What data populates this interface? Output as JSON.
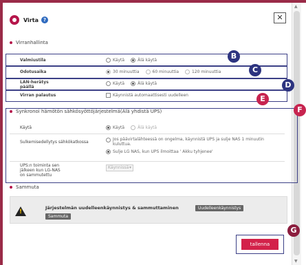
{
  "header": {
    "title": "Virta"
  },
  "sections": {
    "power_management": "Virranhallinta",
    "ups_sync": "Synkronoi hämötön sähkösyöttöjärjestelmä(Älä yhdistä UPS)",
    "shutdown": "Sammuta"
  },
  "power": {
    "standby": {
      "label": "Valmiustila",
      "options": [
        "Käytä",
        "Älä käytä"
      ],
      "selected": "Älä käytä"
    },
    "wait_time": {
      "label": "Odotusaika",
      "options": [
        "30 minuuttia",
        "60 minuuttia",
        "120 minuuttia"
      ],
      "selected": "30 minuuttia"
    },
    "lan_wakeup": {
      "label": "LAN-herätys päällä",
      "options": [
        "Käytä",
        "Älä käytä"
      ],
      "selected": "Älä käytä"
    },
    "power_restore": {
      "label": "Virran palautus",
      "checkbox_label": "Käynnistä automaattisesti uudelleen",
      "checked": false
    }
  },
  "ups": {
    "use": {
      "label": "Käytä",
      "options": [
        "Käytä",
        "Älä käytä"
      ],
      "selected": "Käytä"
    },
    "shutdown_condition": {
      "label": "Sulkemisedellytys sähkökatkossa",
      "option1": "Jos päävirtalähteessä on ongelma, käynnistä UPS ja sulje NAS 1 minuutin kuluttua.",
      "option2": "Sulje LG NAS, kun UPS ilmoittaa ' Akku tyhjenee'"
    },
    "after_shutdown": {
      "label": "UPS:n toiminta sen jälkeen kun LG-NAS on sammutettu",
      "select_value": "Käynnissä"
    }
  },
  "shutdown_panel": {
    "message": "Järjestelmän uudelleenkäynnistys & sammuttaminen",
    "restart_label": "Uudelleenkäynnistys",
    "shutdown_label": "Sammuta"
  },
  "save_label": "tallenna",
  "badges": {
    "b": "B",
    "c": "C",
    "d": "D",
    "e": "E",
    "f": "F",
    "g": "G"
  },
  "colors": {
    "brand": "#b5164b",
    "save": "#d3224a",
    "outline": "#3b3f86"
  }
}
